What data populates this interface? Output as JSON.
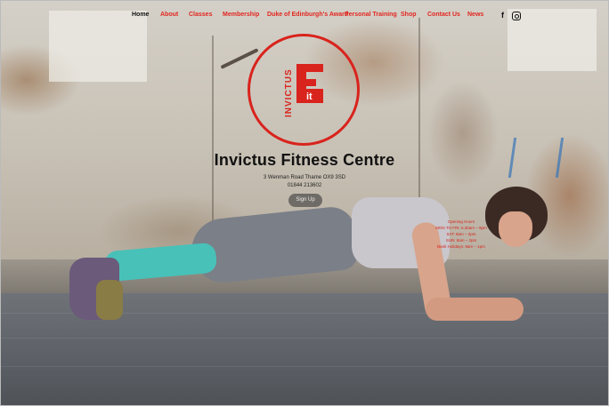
{
  "nav": {
    "items": [
      {
        "label": "Home",
        "active": true
      },
      {
        "label": "About"
      },
      {
        "label": "Classes"
      },
      {
        "label": "Membership"
      },
      {
        "label": "Duke of Edinburgh's Award"
      },
      {
        "label": "Personal Training"
      },
      {
        "label": "Shop"
      },
      {
        "label": "Contact Us"
      },
      {
        "label": "News"
      }
    ],
    "social": [
      {
        "name": "facebook-icon",
        "glyph": "f"
      },
      {
        "name": "instagram-icon"
      }
    ]
  },
  "logo": {
    "vertical_text": "INVICTUS",
    "it_text": "it",
    "color": "#d9231d"
  },
  "hero": {
    "title": "Invictus Fitness Centre",
    "address": "3 Wenman Road Thame OX9 3SD",
    "phone": "01844 213602",
    "signup_label": "Sign Up"
  },
  "hours": {
    "lines": [
      "Opening Hours",
      "MON TO FRI: 6.30am – 9pm",
      "SAT: 8am – 2pm",
      "SUN: 8am – 2pm",
      "Bank Holidays: 9am – 1pm"
    ]
  },
  "colors": {
    "accent": "#e2261f",
    "text": "#111111"
  }
}
